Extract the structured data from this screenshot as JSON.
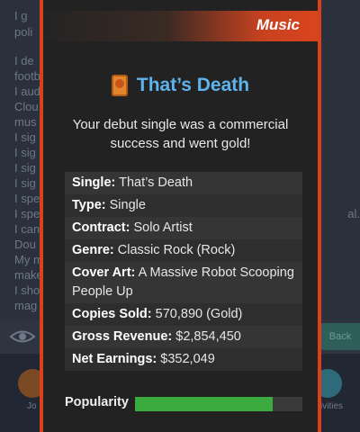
{
  "modal": {
    "category": "Music",
    "title": "That’s Death",
    "description": "Your debut single was a commercial success and went gold!",
    "details": [
      {
        "label": "Single:",
        "value": "That’s Death"
      },
      {
        "label": "Type:",
        "value": "Single"
      },
      {
        "label": "Contract:",
        "value": "Solo Artist"
      },
      {
        "label": "Genre:",
        "value": "Classic Rock (Rock)"
      },
      {
        "label": "Cover Art:",
        "value": "A Massive Robot Scooping People Up"
      },
      {
        "label": "Copies Sold:",
        "value": "570,890 (Gold)"
      },
      {
        "label": "Gross Revenue:",
        "value": "$2,854,450"
      },
      {
        "label": "Net Earnings:",
        "value": "$352,049"
      }
    ],
    "popularity": {
      "label": "Popularity",
      "fraction": 0.82
    }
  },
  "background": {
    "log_left": [
      "I g",
      "poli",
      "I de",
      "footb",
      "I aud",
      "Clou",
      "mus",
      "I sig",
      "I sig",
      "I sig",
      "I sig",
      "I spe",
      "I spe",
      "I can",
      "Dou",
      "My m",
      "make",
      "I sho",
      "mag"
    ],
    "log_right": [
      "al."
    ],
    "control_right": "Back",
    "tabs": [
      "Jo",
      "ivities"
    ]
  },
  "colors": {
    "accent": "#d9411d",
    "title": "#5fb3ec",
    "popularity_fill": "#3bab3f"
  },
  "icons": {
    "title_icon": "gold-record-icon"
  }
}
